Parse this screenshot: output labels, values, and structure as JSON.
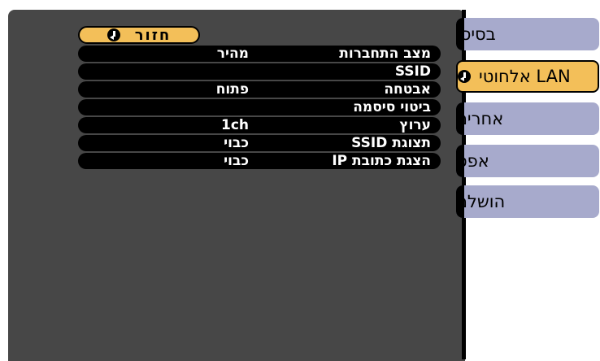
{
  "tabs": [
    {
      "label": "בסיסי",
      "active": false
    },
    {
      "label": "LAN אלחוטי",
      "active": true,
      "icon": "enter-icon"
    },
    {
      "label": "אחרים",
      "active": false
    },
    {
      "label": "אפס",
      "active": false
    },
    {
      "label": "הושלם",
      "active": false
    }
  ],
  "back_button": {
    "label": "חזור",
    "icon": "enter-icon"
  },
  "settings": [
    {
      "label": "מצב התחברות",
      "value": "מהיר"
    },
    {
      "label": "SSID",
      "value": ""
    },
    {
      "label": "אבטחה",
      "value": "פתוח"
    },
    {
      "label": "ביטוי סיסמה",
      "value": ""
    },
    {
      "label": "ערוץ",
      "value": "1ch"
    },
    {
      "label": "תצוגת SSID",
      "value": "כבוי"
    },
    {
      "label": "הצגת כתובת IP",
      "value": "כבוי"
    }
  ],
  "colors": {
    "panel_bg": "#474747",
    "tab_normal": "#a7aacc",
    "accent": "#f3bf59",
    "row_bg": "#000000"
  }
}
